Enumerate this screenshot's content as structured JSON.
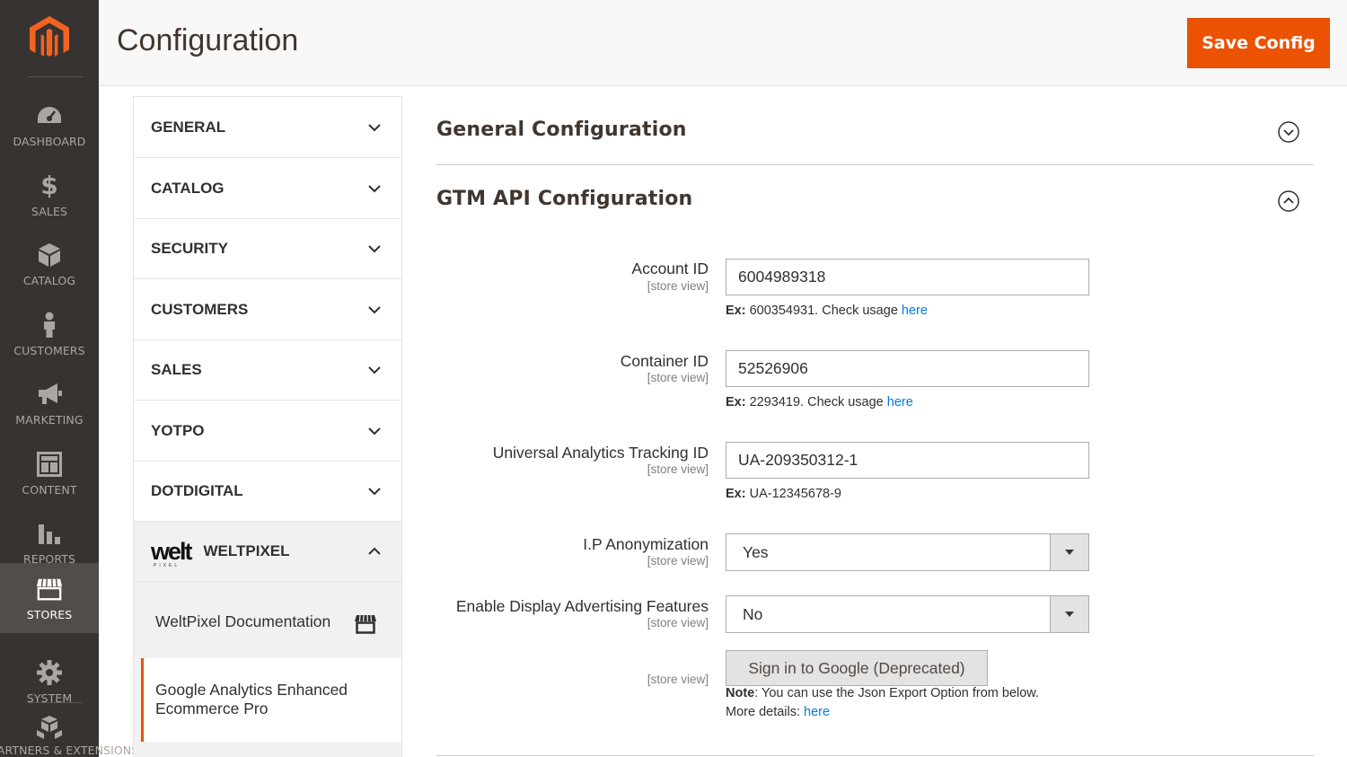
{
  "sidebar": {
    "items": [
      {
        "label": "DASHBOARD",
        "icon": "dashboard-icon"
      },
      {
        "label": "SALES",
        "icon": "dollar-icon"
      },
      {
        "label": "CATALOG",
        "icon": "cube-icon"
      },
      {
        "label": "CUSTOMERS",
        "icon": "person-icon"
      },
      {
        "label": "MARKETING",
        "icon": "megaphone-icon"
      },
      {
        "label": "CONTENT",
        "icon": "layout-icon"
      },
      {
        "label": "REPORTS",
        "icon": "bar-chart-icon"
      },
      {
        "label": "STORES",
        "icon": "storefront-icon",
        "active": true
      },
      {
        "label": "SYSTEM",
        "icon": "gear-icon"
      },
      {
        "label": "FIND PARTNERS & EXTENSIONS",
        "icon": "boxes-icon"
      }
    ],
    "colors": {
      "bg": "#373330",
      "active_bg": "#524d49",
      "text": "#aaa6a0"
    }
  },
  "header": {
    "title": "Configuration",
    "save_label": "Save Config",
    "accent": "#eb5202"
  },
  "config_menu": {
    "items": [
      {
        "label": "GENERAL"
      },
      {
        "label": "CATALOG"
      },
      {
        "label": "SECURITY"
      },
      {
        "label": "CUSTOMERS"
      },
      {
        "label": "SALES"
      },
      {
        "label": "YOTPO"
      },
      {
        "label": "DOTDIGITAL"
      },
      {
        "label": "WELTPIXEL",
        "expanded": true
      }
    ],
    "weltpixel_logo": {
      "word": "welt",
      "sub": "PIXEL"
    },
    "sub_items": {
      "documentation": "WeltPixel Documentation",
      "active": "Google Analytics Enhanced Ecommerce Pro"
    }
  },
  "main": {
    "general_section": "General Configuration",
    "gtm_section": "GTM API Configuration",
    "scope_text": "[store view]",
    "fields": {
      "account_id": {
        "label": "Account ID",
        "value": "6004989318",
        "note_prefix": "Ex:",
        "note_text": " 600354931. Check usage ",
        "note_link": "here"
      },
      "container_id": {
        "label": "Container ID",
        "value": "52526906",
        "note_prefix": "Ex:",
        "note_text": " 2293419. Check usage ",
        "note_link": "here"
      },
      "ua_tracking_id": {
        "label": "Universal Analytics Tracking ID",
        "value": "UA-209350312-1",
        "note_prefix": "Ex:",
        "note_text": " UA-12345678-9"
      },
      "ip_anonymization": {
        "label": "I.P Anonymization",
        "value": "Yes"
      },
      "display_advertising": {
        "label": "Enable Display Advertising Features",
        "value": "No"
      }
    },
    "google_button": "Sign in to Google (Deprecated)",
    "google_note_prefix": "Note",
    "google_note_text": ": You can use the Json Export Option from below.",
    "google_note_more": "More details: ",
    "google_note_link": "here"
  }
}
